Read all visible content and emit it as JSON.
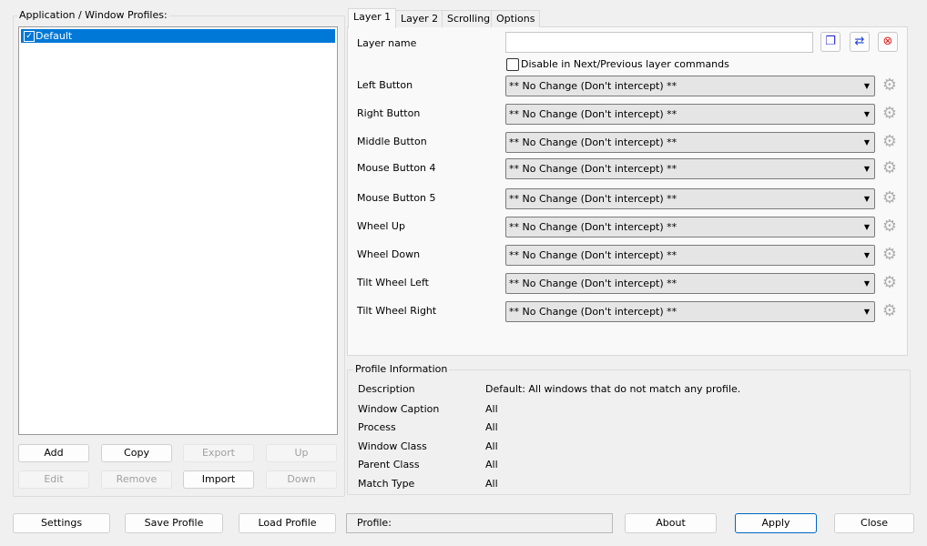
{
  "profiles": {
    "title": "Application / Window Profiles:",
    "items": [
      {
        "label": "Default",
        "checked": true
      }
    ],
    "buttons": {
      "add": "Add",
      "copy": "Copy",
      "export": "Export",
      "up": "Up",
      "edit": "Edit",
      "remove": "Remove",
      "import": "Import",
      "down": "Down"
    }
  },
  "tabs": [
    "Layer 1",
    "Layer 2",
    "Scrolling",
    "Options"
  ],
  "layer": {
    "name_label": "Layer name",
    "name_value": "",
    "disable_label": "Disable in Next/Previous layer commands",
    "rows": [
      {
        "label": "Left Button",
        "value": "** No Change (Don't intercept) **"
      },
      {
        "label": "Right Button",
        "value": "** No Change (Don't intercept) **"
      },
      {
        "label": "Middle Button",
        "value": "** No Change (Don't intercept) **"
      },
      {
        "label": "Mouse Button 4",
        "value": "** No Change (Don't intercept) **"
      },
      {
        "label": "Mouse Button 5",
        "value": "** No Change (Don't intercept) **"
      },
      {
        "label": "Wheel Up",
        "value": "** No Change (Don't intercept) **"
      },
      {
        "label": "Wheel Down",
        "value": "** No Change (Don't intercept) **"
      },
      {
        "label": "Tilt Wheel Left",
        "value": "** No Change (Don't intercept) **"
      },
      {
        "label": "Tilt Wheel Right",
        "value": "** No Change (Don't intercept) **"
      }
    ]
  },
  "info": {
    "title": "Profile Information",
    "rows": [
      {
        "k": "Description",
        "v": "Default: All windows that do not match any profile."
      },
      {
        "k": "Window Caption",
        "v": "All"
      },
      {
        "k": "Process",
        "v": "All"
      },
      {
        "k": "Window Class",
        "v": "All"
      },
      {
        "k": "Parent Class",
        "v": "All"
      },
      {
        "k": "Match Type",
        "v": "All"
      }
    ]
  },
  "bottom": {
    "settings": "Settings",
    "save": "Save Profile",
    "load": "Load Profile",
    "profile": "Profile:",
    "about": "About",
    "apply": "Apply",
    "close": "Close"
  }
}
